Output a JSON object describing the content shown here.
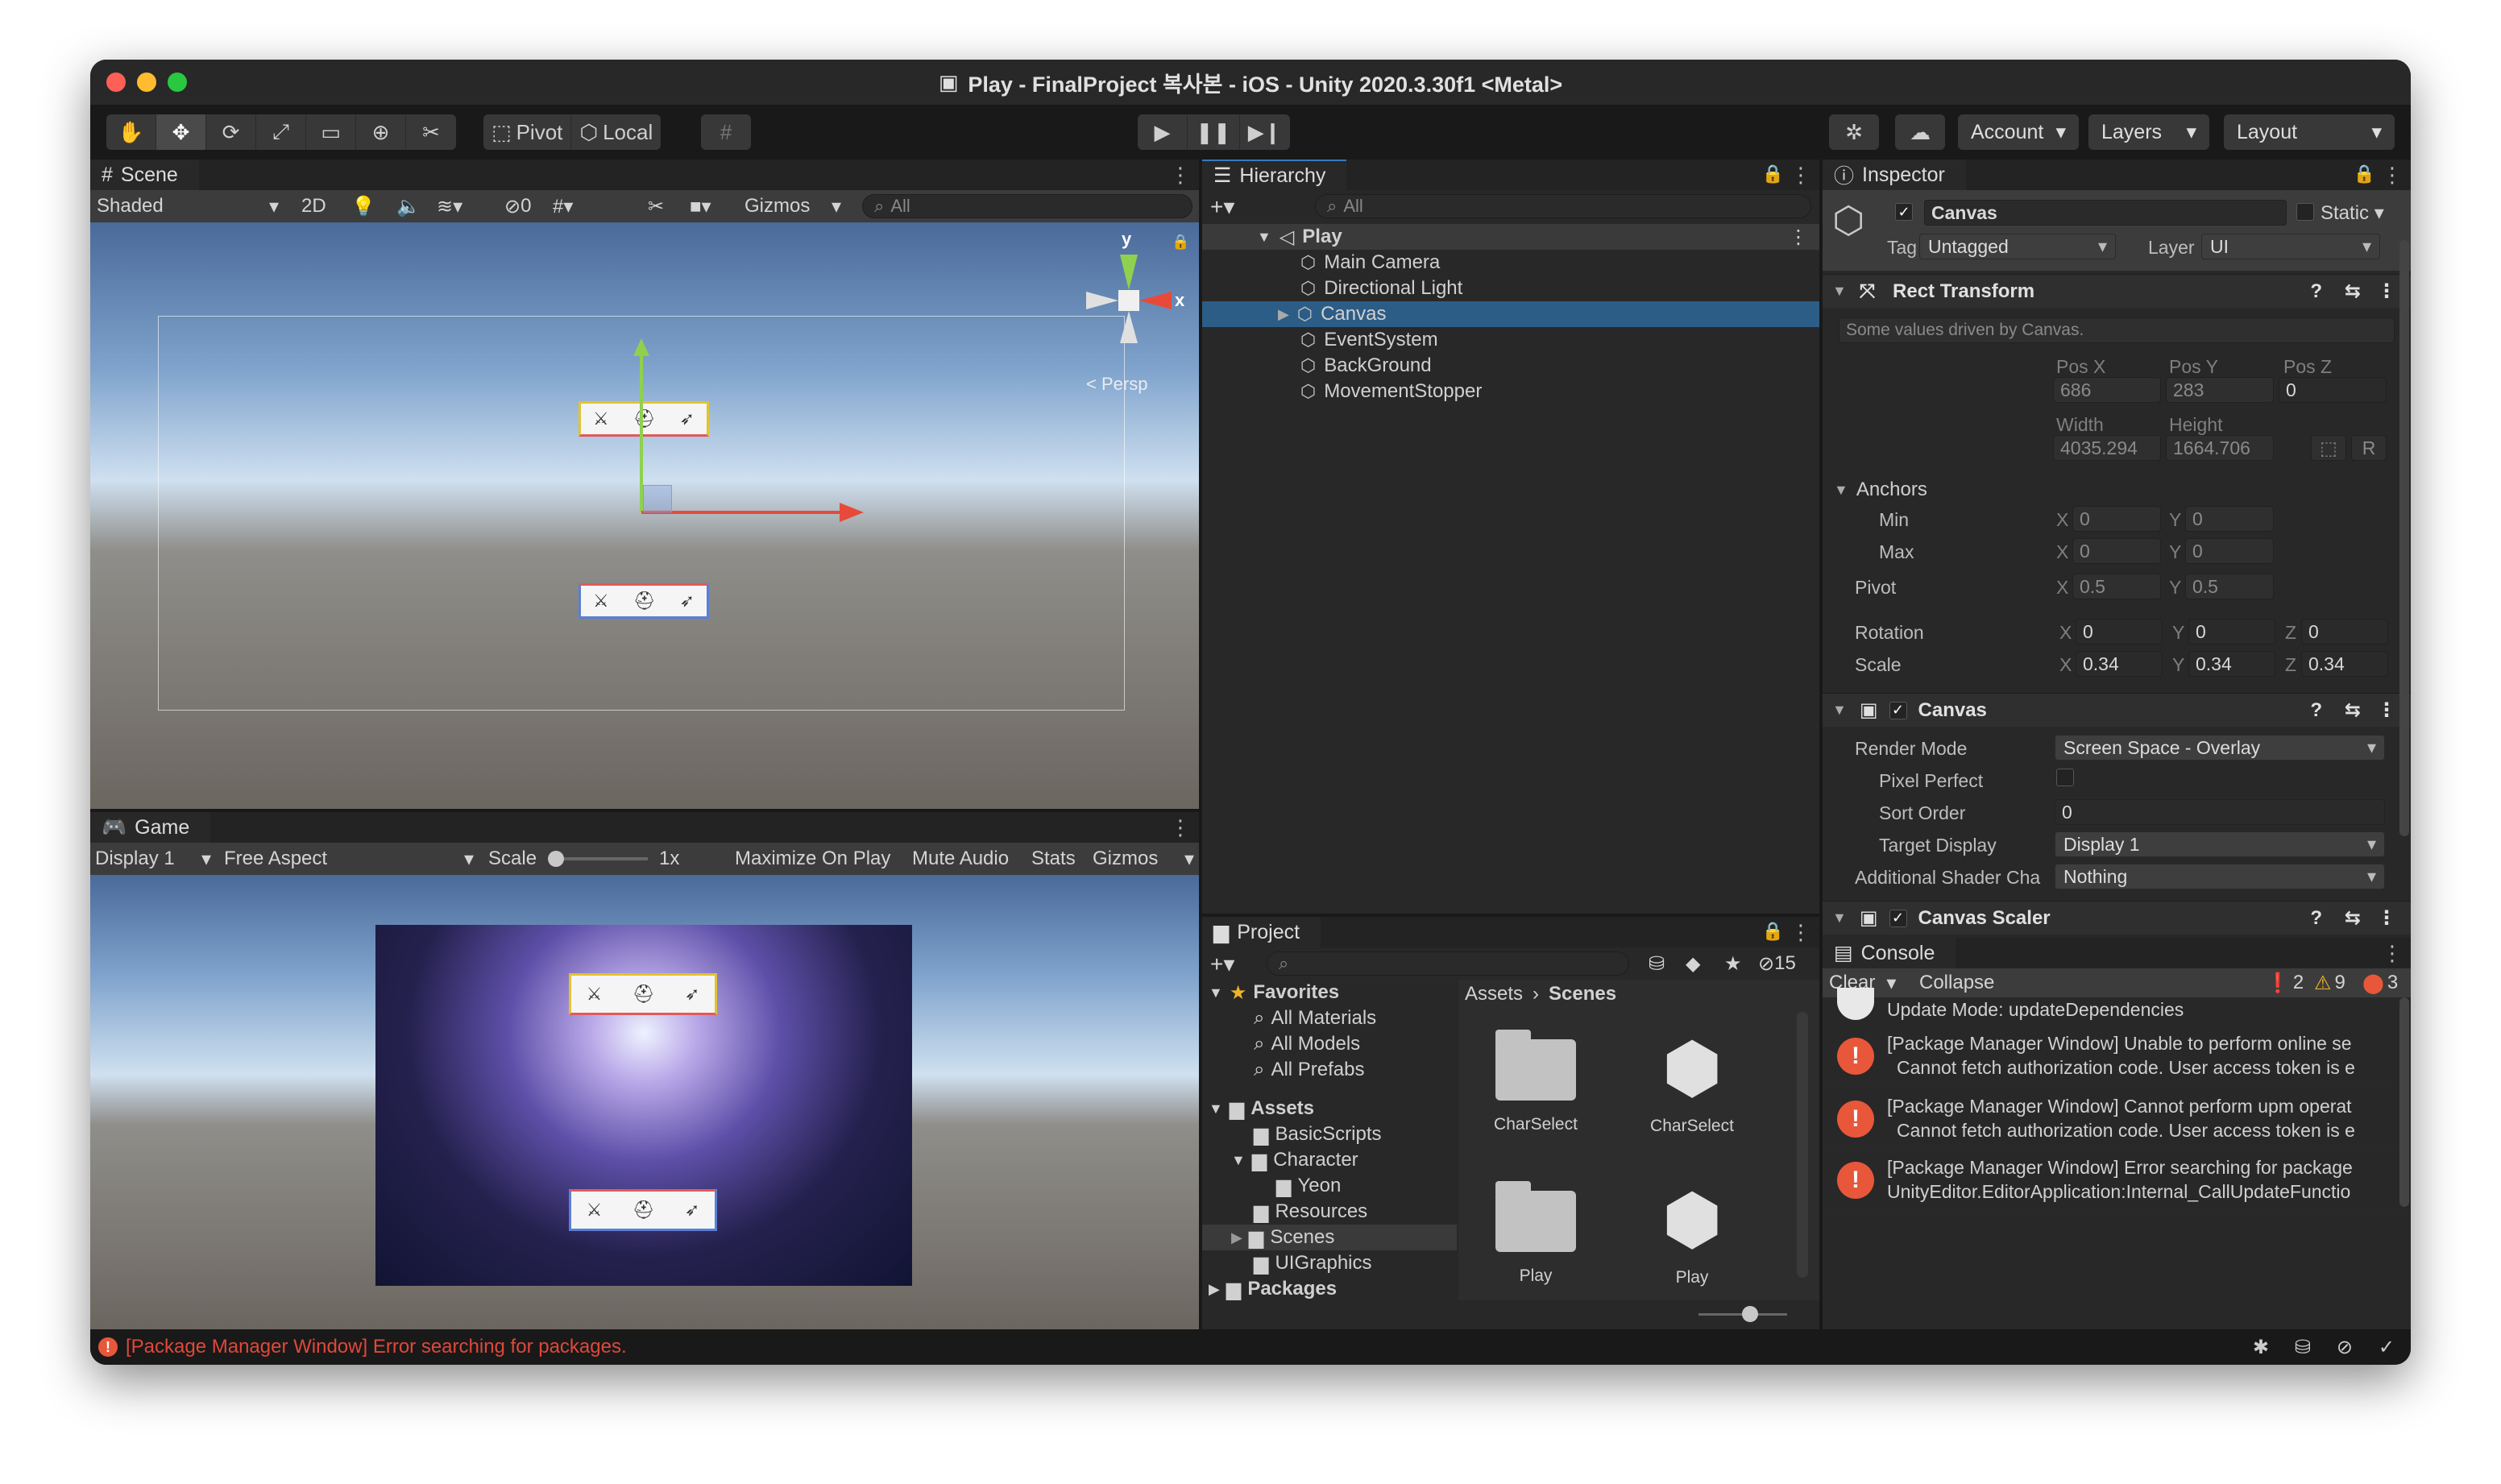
{
  "window": {
    "title": "Play - FinalProject 복사본 - iOS - Unity 2020.3.30f1 <Metal>",
    "status_message": "[Package Manager Window] Error searching for packages."
  },
  "toolbar": {
    "pivot": "Pivot",
    "local": "Local",
    "account": "Account",
    "layers": "Layers",
    "layout": "Layout"
  },
  "scene": {
    "tab": "Scene",
    "shading": "Shaded",
    "mode_2d": "2D",
    "hidden_count": "0",
    "gizmos": "Gizmos",
    "search_placeholder": "All",
    "axis_y": "y",
    "axis_x": "x",
    "persp": "Persp"
  },
  "game": {
    "tab": "Game",
    "display": "Display 1",
    "aspect": "Free Aspect",
    "scale_label": "Scale",
    "scale_value": "1x",
    "maximize": "Maximize On Play",
    "mute": "Mute Audio",
    "stats": "Stats",
    "gizmos": "Gizmos"
  },
  "hierarchy": {
    "tab": "Hierarchy",
    "search_placeholder": "All",
    "scene_name": "Play",
    "items": [
      "Main Camera",
      "Directional Light",
      "Canvas",
      "EventSystem",
      "BackGround",
      "MovementStopper"
    ],
    "selected": "Canvas"
  },
  "project": {
    "tab": "Project",
    "hidden_count": "15",
    "favorites": "Favorites",
    "fav_items": [
      "All Materials",
      "All Models",
      "All Prefabs"
    ],
    "assets": "Assets",
    "asset_tree": [
      "BasicScripts",
      "Character",
      "Yeon",
      "Resources",
      "Scenes",
      "UIGraphics"
    ],
    "packages": "Packages",
    "breadcrumb": [
      "Assets",
      "Scenes"
    ],
    "files": [
      "CharSelect",
      "CharSelect",
      "Play",
      "Play"
    ]
  },
  "inspector": {
    "tab": "Inspector",
    "object_name": "Canvas",
    "static": "Static",
    "tag_label": "Tag",
    "tag_value": "Untagged",
    "layer_label": "Layer",
    "layer_value": "UI",
    "rect_transform": "Rect Transform",
    "driven_note": "Some values driven by Canvas.",
    "pos_x_label": "Pos X",
    "pos_y_label": "Pos Y",
    "pos_z_label": "Pos Z",
    "pos_x": "686",
    "pos_y": "283",
    "pos_z": "0",
    "width_label": "Width",
    "height_label": "Height",
    "width": "4035.294",
    "height": "1664.706",
    "r_button": "R",
    "anchors": "Anchors",
    "min": "Min",
    "max": "Max",
    "min_x": "0",
    "min_y": "0",
    "max_x": "0",
    "max_y": "0",
    "pivot": "Pivot",
    "pivot_x": "0.5",
    "pivot_y": "0.5",
    "rotation": "Rotation",
    "rot_x": "0",
    "rot_y": "0",
    "rot_z": "0",
    "scale": "Scale",
    "scale_x": "0.34",
    "scale_y": "0.34",
    "scale_z": "0.34",
    "x": "X",
    "y": "Y",
    "z": "Z",
    "canvas": "Canvas",
    "render_mode_label": "Render Mode",
    "render_mode": "Screen Space - Overlay",
    "pixel_perfect": "Pixel Perfect",
    "sort_order_label": "Sort Order",
    "sort_order": "0",
    "target_display_label": "Target Display",
    "target_display": "Display 1",
    "shader_label": "Additional Shader Cha",
    "shader_value": "Nothing",
    "canvas_scaler": "Canvas Scaler"
  },
  "console": {
    "tab": "Console",
    "clear": "Clear",
    "collapse": "Collapse",
    "info_count": "2",
    "warn_count": "9",
    "error_count": "3",
    "first_line": "Update Mode: updateDependencies",
    "entries": [
      {
        "line1": "[Package Manager Window] Unable to perform online se",
        "line2": "Cannot fetch authorization code. User access token is e"
      },
      {
        "line1": "[Package Manager Window] Cannot perform upm operat",
        "line2": "Cannot fetch authorization code. User access token is e"
      },
      {
        "line1": "[Package Manager Window] Error searching for package",
        "line2": "UnityEditor.EditorApplication:Internal_CallUpdateFunctio"
      }
    ]
  },
  "colors": {
    "selection": "#2c5d87",
    "error": "#e8573a",
    "warning": "#f0b429"
  }
}
